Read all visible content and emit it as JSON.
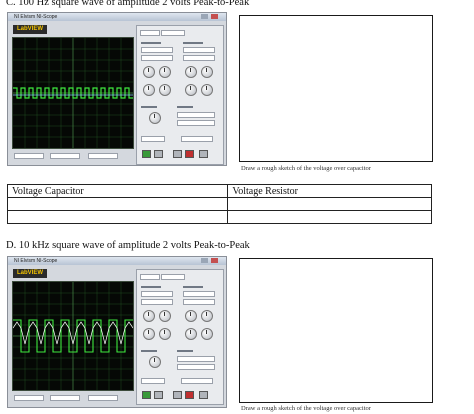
{
  "section_c": {
    "heading": "C. 100 Hz square wave of amplitude 2 volts Peak-to-Peak",
    "window_title": "NI Elvism   NI-Scope",
    "logo": "LabVIEW",
    "caption": "Draw a rough sketch of the voltage over capacitor"
  },
  "table": {
    "headers": [
      "Voltage Capacitor",
      "Voltage Resistor"
    ],
    "rows": [
      [
        "",
        ""
      ],
      [
        "",
        ""
      ]
    ]
  },
  "section_d": {
    "heading": "D. 10 kHz square wave of amplitude 2 volts Peak-to-Peak",
    "window_title": "NI Elvism   NI-Scope",
    "logo": "LabVIEW",
    "caption": "Draw a rough sketch of the voltage over capacitor"
  },
  "colors": {
    "trace": "#3fe83f",
    "scope_bg": "#050805",
    "grid": "#2a5a2a"
  },
  "icons": [
    "labview-logo",
    "oscilloscope-display",
    "knob",
    "run-button",
    "stop-button"
  ]
}
